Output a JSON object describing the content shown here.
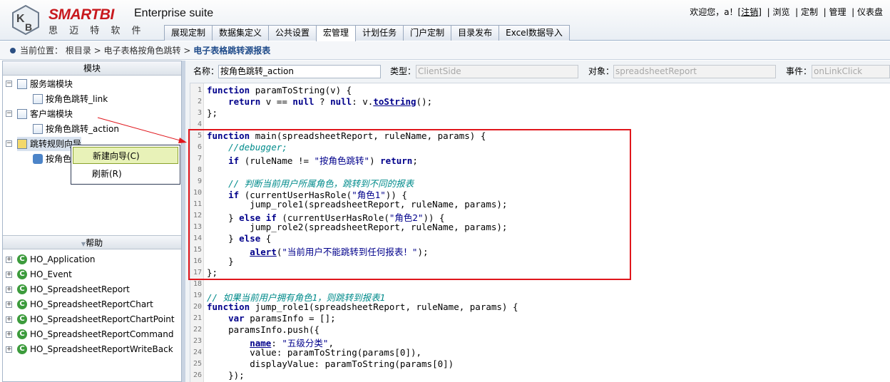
{
  "header": {
    "brand": "SMARTBI",
    "brand_cn": "思 迈 特 软 件",
    "suite": "Enterprise suite",
    "welcome": "欢迎您，a！[",
    "logout": "注销",
    "welcome_end": "]",
    "links": [
      "浏览",
      "定制",
      "管理",
      "仪表盘"
    ],
    "tabs": [
      "展现定制",
      "数据集定义",
      "公共设置",
      "宏管理",
      "计划任务",
      "门户定制",
      "目录发布",
      "Excel数据导入"
    ],
    "active_tab": "宏管理"
  },
  "breadcrumb": {
    "prefix": "当前位置：",
    "path": "根目录 > 电子表格按角色跳转 >",
    "current": "电子表格跳转源报表"
  },
  "left": {
    "module_title": "模块",
    "help_title": "帮助",
    "tree": [
      {
        "label": "服务端模块",
        "child": "按角色跳转_link"
      },
      {
        "label": "客户端模块",
        "child": "按角色跳转_action"
      },
      {
        "label": "跳转规则向导",
        "child": "按角色"
      }
    ],
    "help_items": [
      "HO_Application",
      "HO_Event",
      "HO_SpreadsheetReport",
      "HO_SpreadsheetReportChart",
      "HO_SpreadsheetReportChartPoint",
      "HO_SpreadsheetReportCommand",
      "HO_SpreadsheetReportWriteBack"
    ]
  },
  "context_menu": [
    "新建向导(C)",
    "刷新(R)"
  ],
  "form": {
    "name_label": "名称：",
    "name_value": "按角色跳转_action",
    "type_label": "类型：",
    "type_value": "ClientSide",
    "object_label": "对象：",
    "object_value": "spreadsheetReport",
    "event_label": "事件：",
    "event_value": "onLinkClick"
  },
  "code_lines": [
    "function paramToString(v) {",
    "    return v == null ? null: v.toString();",
    "};",
    "",
    "function main(spreadsheetReport, ruleName, params) {",
    "    //debugger;",
    "    if (ruleName != \"按角色跳转\") return;",
    "",
    "    // 判断当前用户所属角色，跳转到不同的报表",
    "    if (currentUserHasRole(\"角色1\")) {",
    "        jump_role1(spreadsheetReport, ruleName, params);",
    "    } else if (currentUserHasRole(\"角色2\")) {",
    "        jump_role2(spreadsheetReport, ruleName, params);",
    "    } else {",
    "        alert(\"当前用户不能跳转到任何报表！\");",
    "    }",
    "};",
    "",
    "// 如果当前用户拥有角色1，则跳转到报表1",
    "function jump_role1(spreadsheetReport, ruleName, params) {",
    "    var paramsInfo = [];",
    "    paramsInfo.push({",
    "        name: \"五级分类\",",
    "        value: paramToString(params[0]),",
    "        displayValue: paramToString(params[0])",
    "    });"
  ]
}
